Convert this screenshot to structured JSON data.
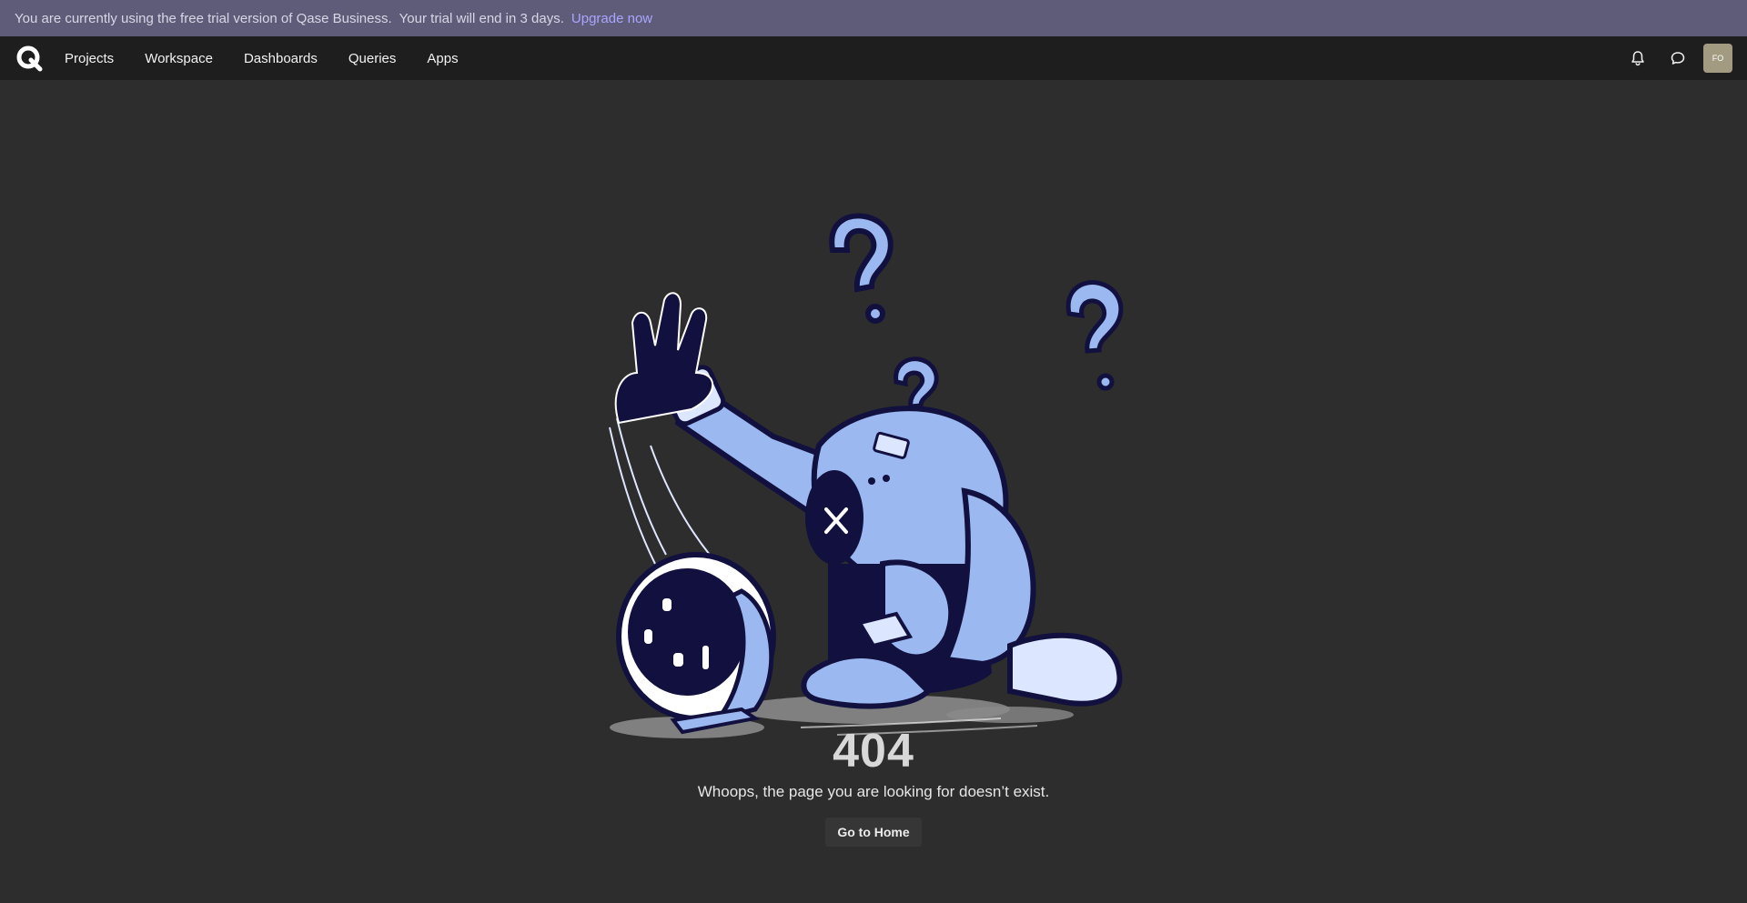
{
  "banner": {
    "message_part1": "You are currently using the free trial version of Qase Business.",
    "message_part2": "Your trial will end in 3 days.",
    "upgrade_label": "Upgrade now"
  },
  "nav": {
    "logo_icon": "qase-logo-icon",
    "items": [
      {
        "label": "Projects"
      },
      {
        "label": "Workspace"
      },
      {
        "label": "Dashboards"
      },
      {
        "label": "Queries"
      },
      {
        "label": "Apps"
      }
    ],
    "notifications_icon": "bell-icon",
    "chat_icon": "chat-bubble-icon",
    "avatar_initials": "FO"
  },
  "error": {
    "code": "404",
    "message": "Whoops, the page you are looking for doesn’t exist.",
    "button_label": "Go to Home"
  },
  "colors": {
    "banner_bg": "#5f5c79",
    "nav_bg": "#1e1e1e",
    "page_bg": "#2d2d2d",
    "link": "#a9a6ff",
    "avatar_bg": "#a39a82",
    "illustration_light": "#9bb8f0",
    "illustration_dark": "#12103f"
  }
}
